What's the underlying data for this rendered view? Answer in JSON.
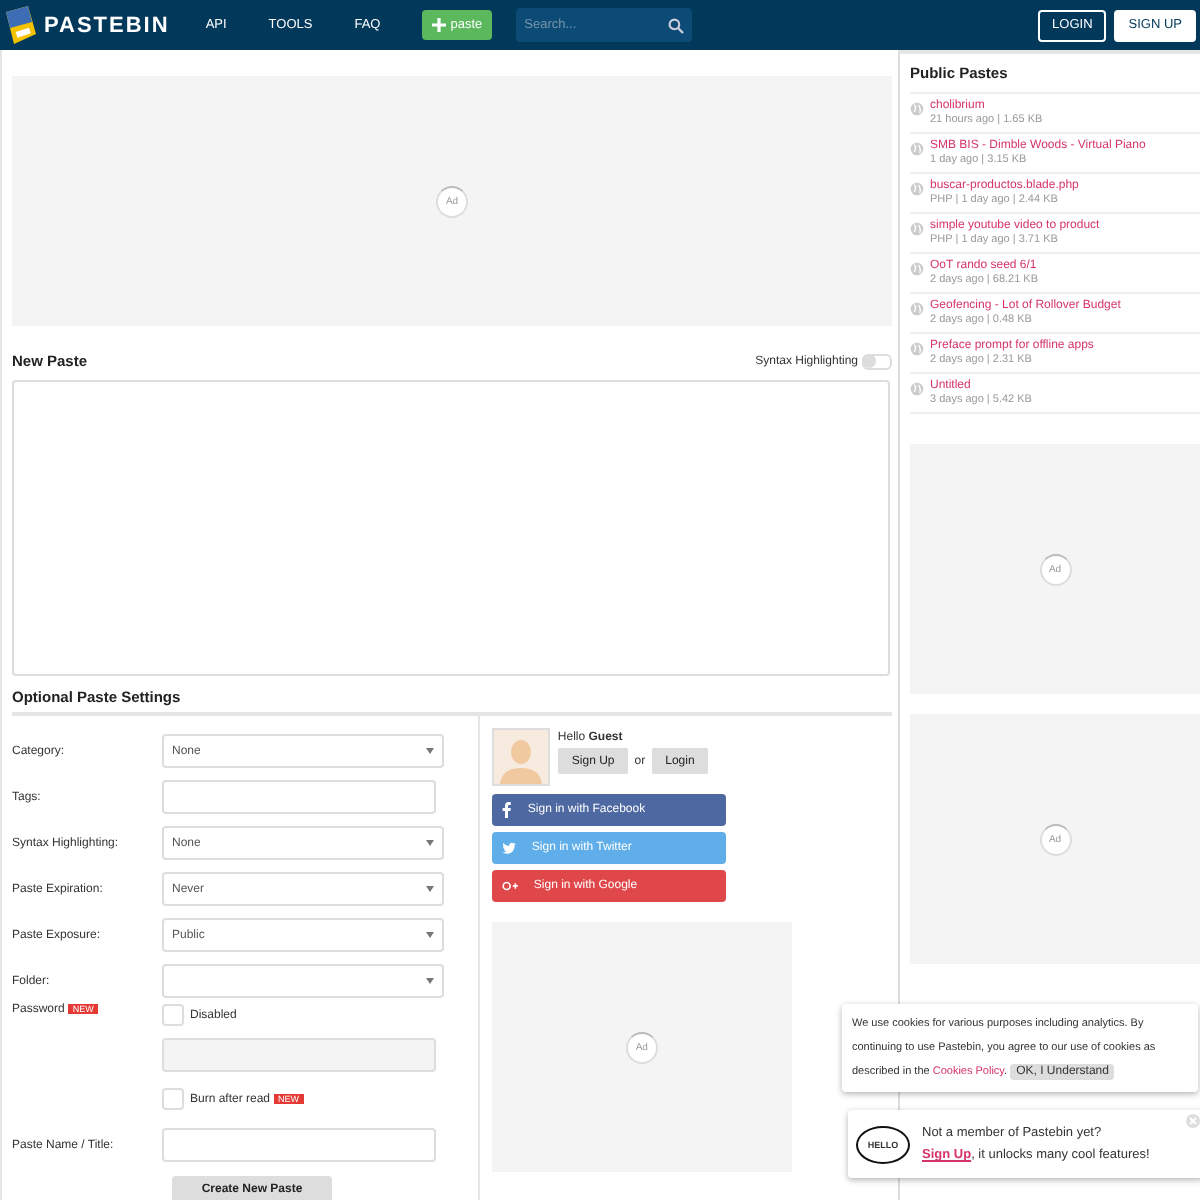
{
  "header": {
    "logo": "PASTEBIN",
    "nav": [
      "API",
      "TOOLS",
      "FAQ"
    ],
    "new_paste": "paste",
    "search": {
      "placeholder": "Search..."
    },
    "login": "LOGIN",
    "signup": "SIGN UP"
  },
  "top_ad": "Ad",
  "new_paste": {
    "title": "New Paste",
    "syntax_toggle": {
      "label": "Syntax Highlighting",
      "on": false
    }
  },
  "settings": {
    "title": "Optional Paste Settings",
    "fields": [
      {
        "kind": "select",
        "label": "Category:",
        "value": "None"
      },
      {
        "kind": "text",
        "label": "Tags:"
      },
      {
        "kind": "select",
        "label": "Syntax Highlighting:",
        "value": "None"
      },
      {
        "kind": "select",
        "label": "Paste Expiration:",
        "value": "Never"
      },
      {
        "kind": "select",
        "label": "Paste Exposure:",
        "value": "Public"
      },
      {
        "kind": "select",
        "label": "Folder:"
      },
      {
        "kind": "password",
        "label": "Password",
        "badge": "NEW",
        "checkbox_label": "Disabled",
        "checked": false
      },
      {
        "kind": "checkbox",
        "checkbox_label": "Burn after read",
        "badge": "NEW",
        "checked": false
      },
      {
        "kind": "text",
        "label": "Paste Name / Title:"
      }
    ],
    "submit": "Create New Paste"
  },
  "account": {
    "greeting": "Hello",
    "name": "Guest",
    "signup": "Sign Up",
    "or": "or",
    "login": "Login",
    "social": [
      {
        "kind": "facebook",
        "label": "Sign in with Facebook"
      },
      {
        "kind": "twitter",
        "label": "Sign in with Twitter"
      },
      {
        "kind": "google",
        "label": "Sign in with Google"
      }
    ],
    "ad": "Ad"
  },
  "sidebar": {
    "title": "Public Pastes",
    "pastes": [
      {
        "title": "cholibrium",
        "meta": "21 hours ago | 1.65 KB"
      },
      {
        "title": "SMB BIS - Dimble Woods - Virtual Piano",
        "meta": "1 day ago | 3.15 KB"
      },
      {
        "title": "buscar-productos.blade.php",
        "meta": "PHP | 1 day ago | 2.44 KB"
      },
      {
        "title": "simple youtube video to product",
        "meta": "PHP | 1 day ago | 3.71 KB"
      },
      {
        "title": "OoT rando seed 6/1",
        "meta": "2 days ago | 68.21 KB"
      },
      {
        "title": "Geofencing - Lot of Rollover Budget",
        "meta": "2 days ago | 0.48 KB"
      },
      {
        "title": "Preface prompt for offline apps",
        "meta": "2 days ago | 2.31 KB"
      },
      {
        "title": "Untitled",
        "meta": "3 days ago | 5.42 KB"
      }
    ],
    "ads": [
      "Ad",
      "Ad"
    ]
  },
  "cookie": {
    "text": "We use cookies for various purposes including analytics. By continuing to use Pastebin, you agree to our use of cookies as described in the ",
    "link": "Cookies Policy",
    "after": ".",
    "button": "OK, I Understand"
  },
  "member": {
    "bubble": "HELLO",
    "question": "Not a member of Pastebin yet?",
    "link": "Sign Up",
    "rest": ", it unlocks many cool features!"
  }
}
